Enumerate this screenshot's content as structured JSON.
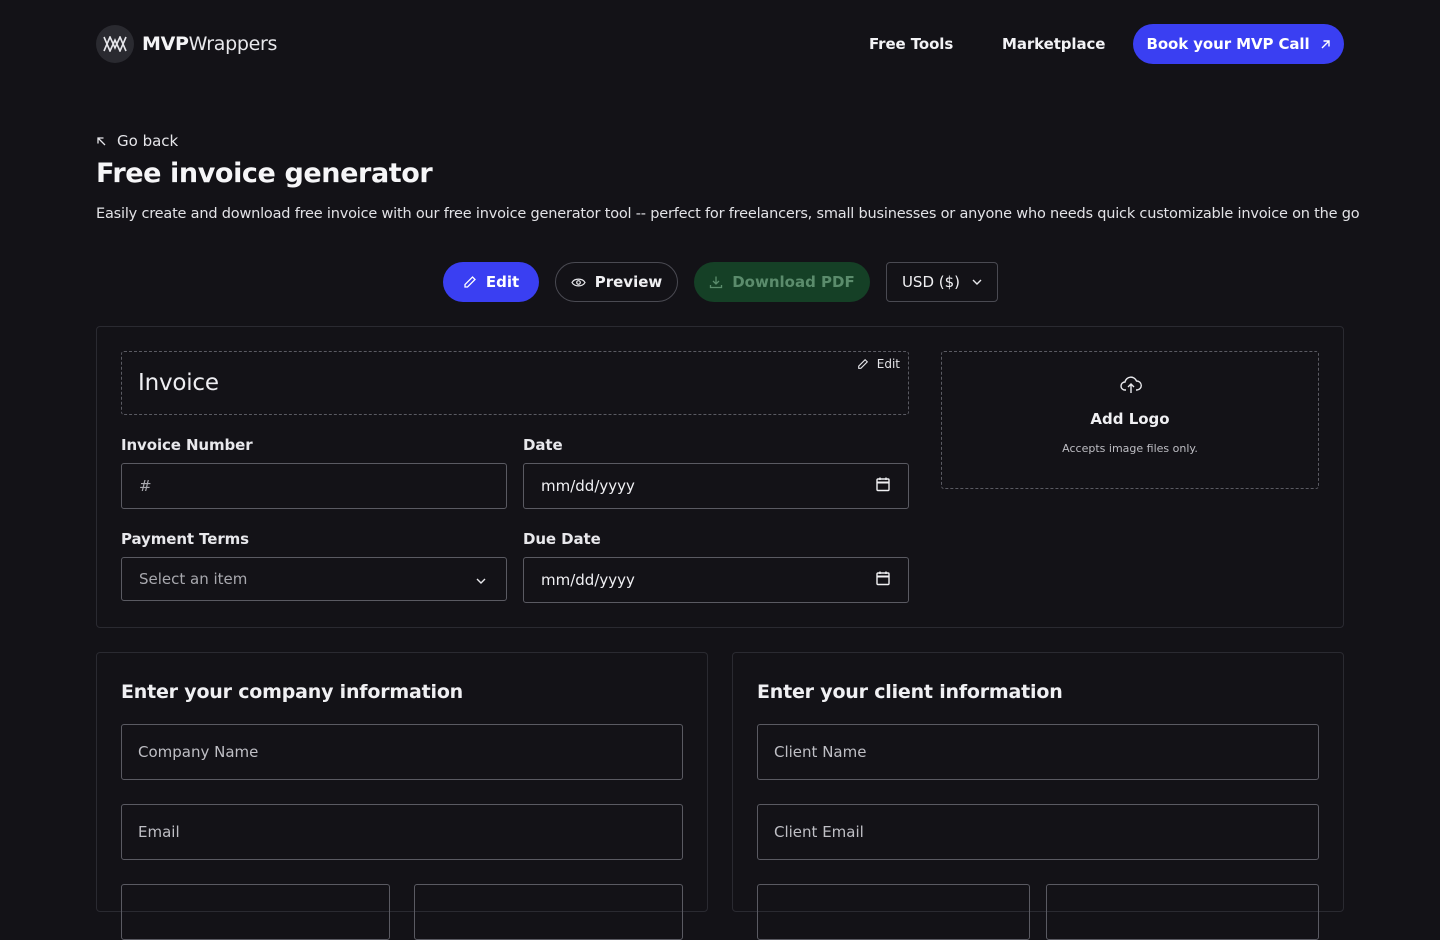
{
  "header": {
    "brand_bold": "MVP",
    "brand_light": "Wrappers",
    "nav": [
      {
        "label": "Free Tools"
      },
      {
        "label": "Marketplace"
      }
    ],
    "cta_label": "Book your MVP Call"
  },
  "page": {
    "go_back": "Go back",
    "title": "Free invoice generator",
    "description": "Easily create and download free invoice with our free invoice generator tool -- perfect for freelancers, small businesses or anyone who needs quick customizable invoice on the go"
  },
  "toolbar": {
    "edit_label": "Edit",
    "preview_label": "Preview",
    "download_label": "Download PDF",
    "currency_value": "USD ($)"
  },
  "invoice": {
    "title": "Invoice",
    "title_edit_label": "Edit",
    "logo_title": "Add Logo",
    "logo_hint": "Accepts image files only.",
    "invoice_number_label": "Invoice Number",
    "invoice_number_placeholder": "#",
    "date_label": "Date",
    "date_placeholder": "mm/dd/yyyy",
    "payment_terms_label": "Payment Terms",
    "payment_terms_placeholder": "Select an item",
    "due_date_label": "Due Date",
    "due_date_placeholder": "mm/dd/yyyy"
  },
  "company": {
    "title": "Enter your company information",
    "name_placeholder": "Company Name",
    "email_placeholder": "Email"
  },
  "client": {
    "title": "Enter your client information",
    "name_placeholder": "Client Name",
    "email_placeholder": "Client Email"
  },
  "colors": {
    "background": "#131217",
    "accent": "#3a3ff2",
    "download_bg": "#154026"
  }
}
